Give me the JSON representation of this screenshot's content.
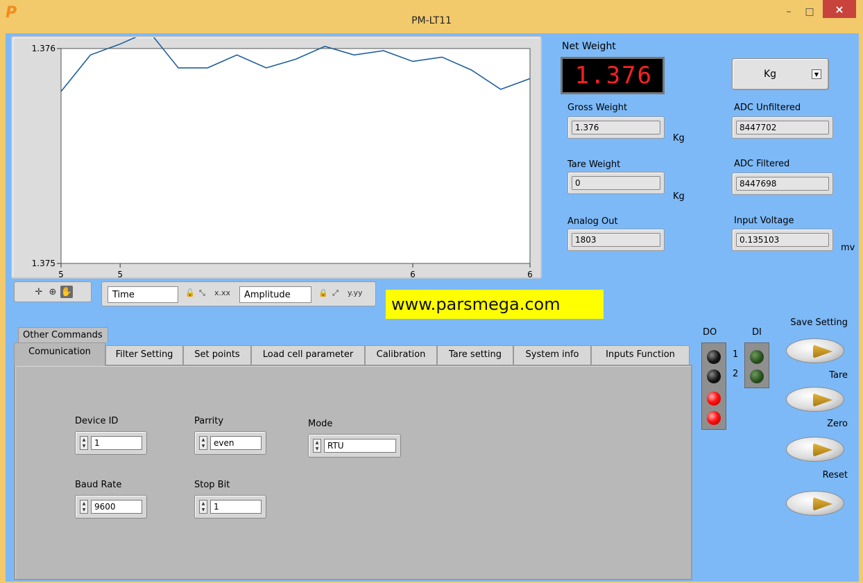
{
  "window": {
    "title": "PM-LT11",
    "logo": "P",
    "minimize_icon": "–",
    "maximize_icon": "□",
    "close_icon": "×"
  },
  "chart_data": {
    "type": "line",
    "title": "",
    "xlabel": "Time",
    "ylabel": "Amplitude",
    "x_ticks": [
      "5",
      "5",
      "6",
      "6"
    ],
    "y_ticks": [
      "1.376",
      "1.375"
    ],
    "ylim": [
      1.375,
      1.376
    ],
    "grid": false,
    "series": [
      {
        "values": [
          1.3758,
          1.37597,
          1.37602,
          1.37608,
          1.37591,
          1.37591,
          1.37597,
          1.37591,
          1.37595,
          1.37601,
          1.37597,
          1.37599,
          1.37594,
          1.37596,
          1.3759,
          1.37581,
          1.37586
        ],
        "color": "#1f5f9e"
      }
    ]
  },
  "graph_tools": {
    "x_scale": "Time",
    "y_scale": "Amplitude"
  },
  "website": "www.parsmega.com",
  "indicators": {
    "net_weight_label": "Net Weight",
    "net_weight_value": "1.376",
    "gross_weight_label": "Gross Weight",
    "gross_weight_value": "1.376",
    "gross_weight_unit": "Kg",
    "tare_weight_label": "Tare  Weight",
    "tare_weight_value": "0",
    "tare_weight_unit": "Kg",
    "analog_out_label": "Analog Out",
    "analog_out_value": "1803",
    "adc_unfiltered_label": "ADC  Unfiltered",
    "adc_unfiltered_value": "8447702",
    "adc_filtered_label": "ADC Filtered",
    "adc_filtered_value": "8447698",
    "input_voltage_label": "Input Voltage",
    "input_voltage_value": "0.135103",
    "input_voltage_unit": "mv",
    "unit_select": "Kg"
  },
  "tabs": {
    "other_commands": "Other Commands",
    "items": [
      "Comunication",
      "Filter Setting",
      "Set points",
      "Load cell parameter",
      "Calibration",
      "Tare setting",
      "System info",
      "Inputs Function"
    ],
    "selected": "Comunication"
  },
  "communication": {
    "device_id_label": "Device ID",
    "device_id": "1",
    "parity_label": "Parrity",
    "parity": "even",
    "mode_label": "Mode",
    "mode": "RTU",
    "baud_rate_label": "Baud Rate",
    "baud_rate": "9600",
    "stop_bit_label": "Stop Bit",
    "stop_bit": "1"
  },
  "io": {
    "do_label": "DO",
    "di_label": "DI",
    "di_1": "1",
    "di_2": "2",
    "do_states": [
      "off",
      "off",
      "on",
      "on"
    ],
    "di_states": [
      "off",
      "off"
    ],
    "colors": {
      "led_on": "#ff1010",
      "led_off": "#111111",
      "di_off": "#244a1a"
    }
  },
  "actions": {
    "save_setting": "Save Setting",
    "tare": "Tare",
    "zero": "Zero",
    "reset": "Reset"
  }
}
